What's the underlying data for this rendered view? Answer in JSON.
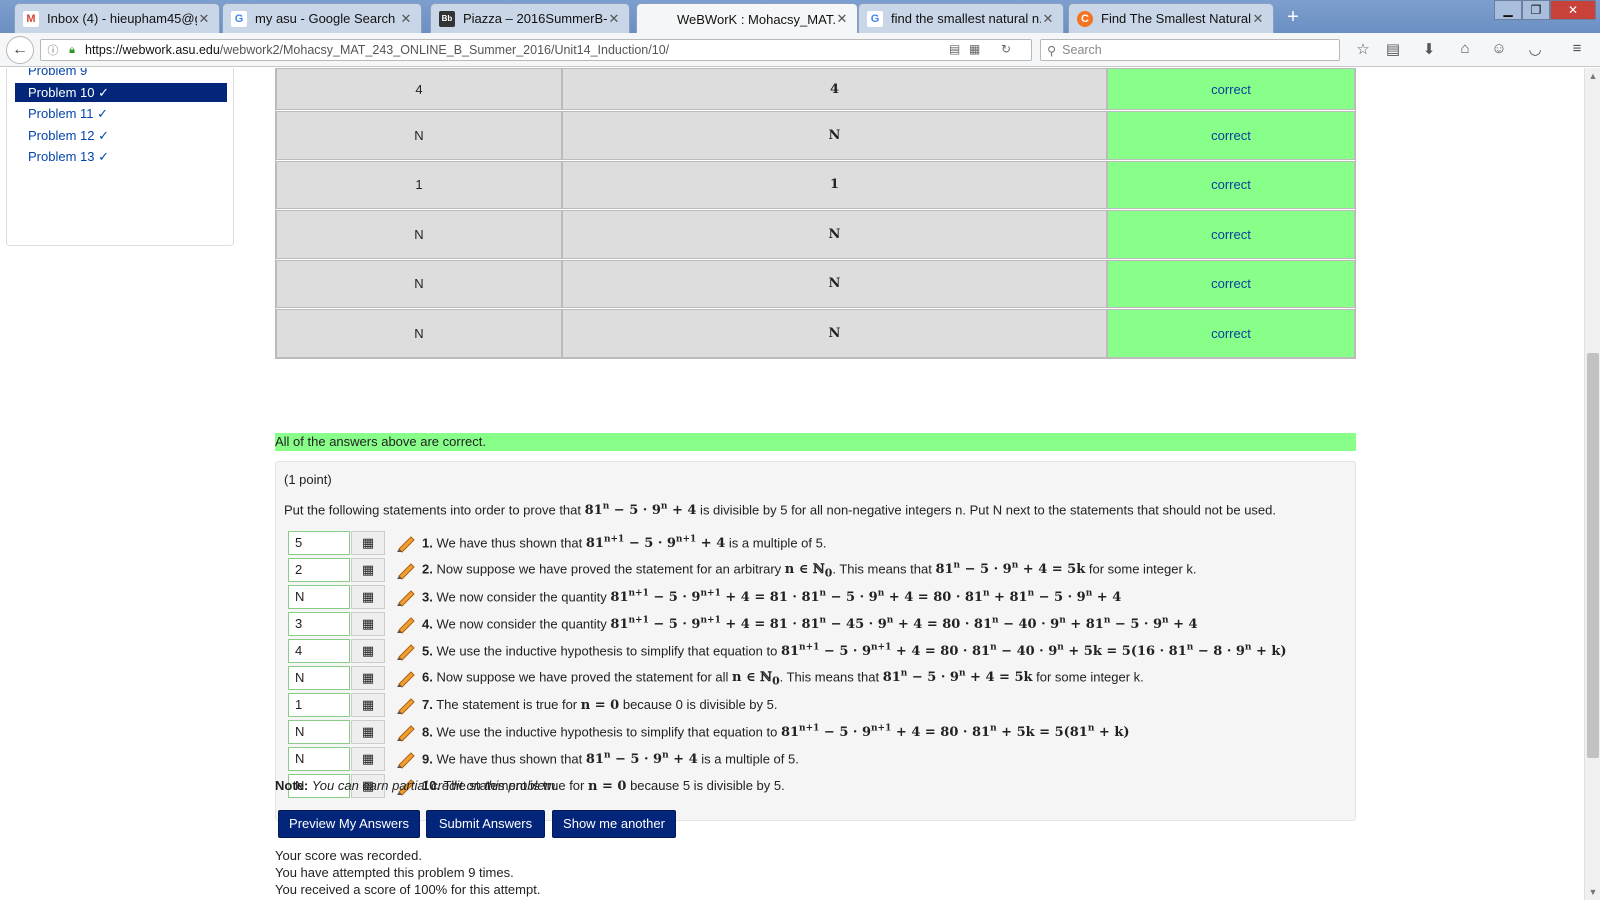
{
  "browser": {
    "tabs": [
      {
        "title": "Inbox (4) - hieupham45@g...",
        "icon": "gmail-icon",
        "color": "#d44638",
        "glyph": "M"
      },
      {
        "title": "my asu - Google Search",
        "icon": "google-icon",
        "color": "#ffffff",
        "glyph": "G"
      },
      {
        "title": "Piazza – 2016SummerB-X-...",
        "icon": "blackboard-icon",
        "color": "#333333",
        "glyph": "Bb"
      },
      {
        "title": "WeBWorK : Mohacsy_MAT...",
        "icon": "webwork-icon",
        "color": "#ffffff",
        "glyph": ""
      },
      {
        "title": "find the smallest natural n...",
        "icon": "google-icon",
        "color": "#ffffff",
        "glyph": "G"
      },
      {
        "title": "Find The Smallest Natural ...",
        "icon": "chegg-icon",
        "color": "#f47321",
        "glyph": "C"
      }
    ],
    "active_tab": 3,
    "url_host": "https://webwork.asu.edu",
    "url_path": "/webwork2/Mohacsy_MAT_243_ONLINE_B_Summer_2016/Unit14_Induction/10/",
    "search_placeholder": "Search"
  },
  "sidebar": {
    "items": [
      {
        "label": "Problem 9"
      },
      {
        "label": "Problem 10 ✓",
        "active": true
      },
      {
        "label": "Problem 11 ✓"
      },
      {
        "label": "Problem 12 ✓"
      },
      {
        "label": "Problem 13 ✓"
      }
    ]
  },
  "results": {
    "rows": [
      {
        "entered": "4",
        "preview": "4",
        "result": "correct"
      },
      {
        "entered": "N",
        "preview": "N",
        "result": "correct"
      },
      {
        "entered": "1",
        "preview": "1",
        "result": "correct"
      },
      {
        "entered": "N",
        "preview": "N",
        "result": "correct"
      },
      {
        "entered": "N",
        "preview": "N",
        "result": "correct"
      },
      {
        "entered": "N",
        "preview": "N",
        "result": "correct"
      }
    ],
    "summary": "All of the answers above are correct."
  },
  "problem": {
    "points": "(1 point)",
    "prompt_a": "Put the following statements into order to prove that ",
    "prompt_b": " is divisible by 5 for all non-negative integers n. Put N next to the statements that should not be used.",
    "statements": [
      {
        "answer": "5",
        "num": "1.",
        "pre": "We have thus shown that",
        "post": "is a multiple of 5."
      },
      {
        "answer": "2",
        "num": "2.",
        "pre": "Now suppose we have proved the statement for an arbitrary",
        "post": "for some integer k."
      },
      {
        "answer": "N",
        "num": "3.",
        "pre": "We now consider the quantity",
        "post": ""
      },
      {
        "answer": "3",
        "num": "4.",
        "pre": "We now consider the quantity",
        "post": ""
      },
      {
        "answer": "4",
        "num": "5.",
        "pre": "We use the inductive hypothesis to simplify that equation to",
        "post": ""
      },
      {
        "answer": "N",
        "num": "6.",
        "pre": "Now suppose we have proved the statement for all",
        "post": "for some integer k."
      },
      {
        "answer": "1",
        "num": "7.",
        "pre": "The statement is true for",
        "post": "because 0 is divisible by 5."
      },
      {
        "answer": "N",
        "num": "8.",
        "pre": "We use the inductive hypothesis to simplify that equation to",
        "post": ""
      },
      {
        "answer": "N",
        "num": "9.",
        "pre": "We have thus shown that",
        "post": "is a multiple of 5."
      },
      {
        "answer": "N",
        "num": "10.",
        "pre": "The statement is true for",
        "post": "because 5 is divisible by 5."
      }
    ]
  },
  "note": {
    "label": "Note:",
    "text": "You can earn partial credit on this problem."
  },
  "buttons": {
    "preview": "Preview My Answers",
    "submit": "Submit Answers",
    "another": "Show me another"
  },
  "messages": [
    "Your score was recorded.",
    "You have attempted this problem 9 times.",
    "You received a score of 100% for this attempt."
  ]
}
